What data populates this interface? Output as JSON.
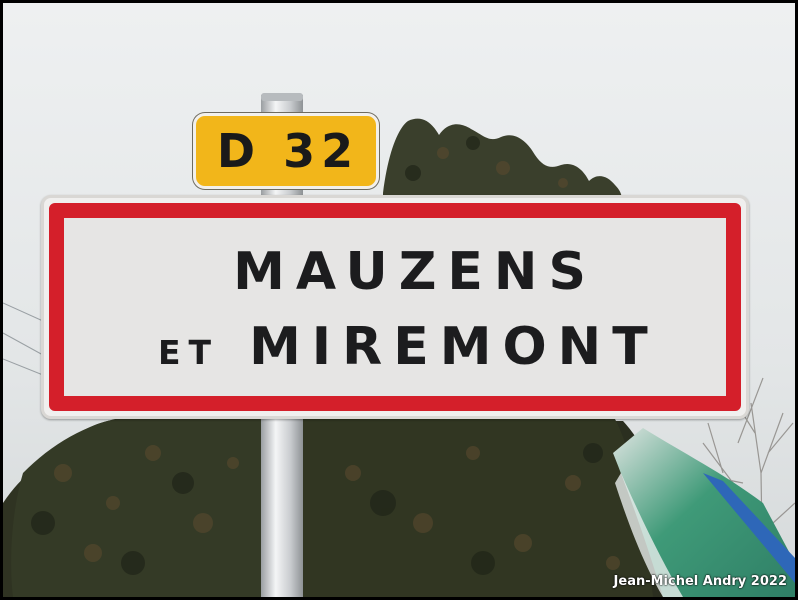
{
  "route_plate": {
    "text": "D 32",
    "color": "#f2b61a"
  },
  "town_sign": {
    "line1": "MAUZENS",
    "line2_prefix": "ET",
    "line2_name": "MIREMONT",
    "border_color": "#d41f2a",
    "background_color": "#e6e5e4"
  },
  "credit": {
    "text": "Jean-Michel Andry 2022"
  }
}
